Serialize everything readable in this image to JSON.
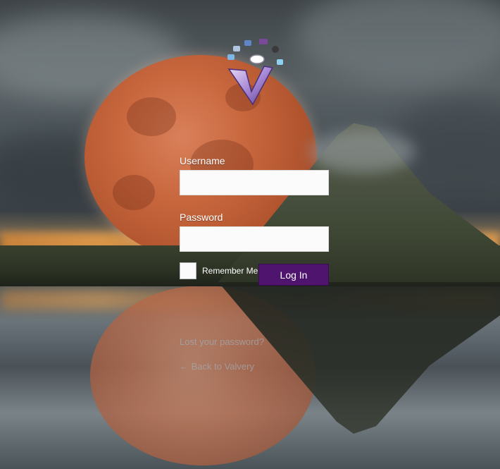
{
  "form": {
    "username_label": "Username",
    "username_value": "",
    "password_label": "Password",
    "password_value": "",
    "remember_label": "Remember Me",
    "remember_checked": false,
    "login_label": "Log In"
  },
  "links": {
    "lost_password": "Lost your password?",
    "back_to_site": "← Back to Valvery"
  },
  "colors": {
    "login_button": "#4e146e",
    "moon": "#c8673e",
    "text": "#ffffff"
  },
  "icons": [
    "site-logo-icon"
  ]
}
